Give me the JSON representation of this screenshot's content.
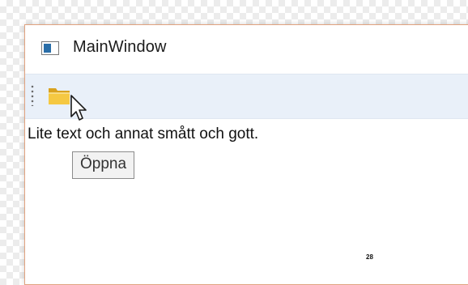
{
  "window": {
    "title": "MainWindow"
  },
  "toolbar": {
    "open_icon": "folder-icon",
    "grip_icon": "toolbar-grip-icon"
  },
  "content": {
    "text": "Lite text och annat smått och gott."
  },
  "tooltip": {
    "text": "Öppna"
  },
  "footer": {
    "page_number": "28"
  },
  "colors": {
    "window_border": "#e0a27f",
    "toolbar_background": "#e9f0f9",
    "folder_yellow": "#f5c842",
    "app_icon_blue": "#2a6ea8"
  }
}
